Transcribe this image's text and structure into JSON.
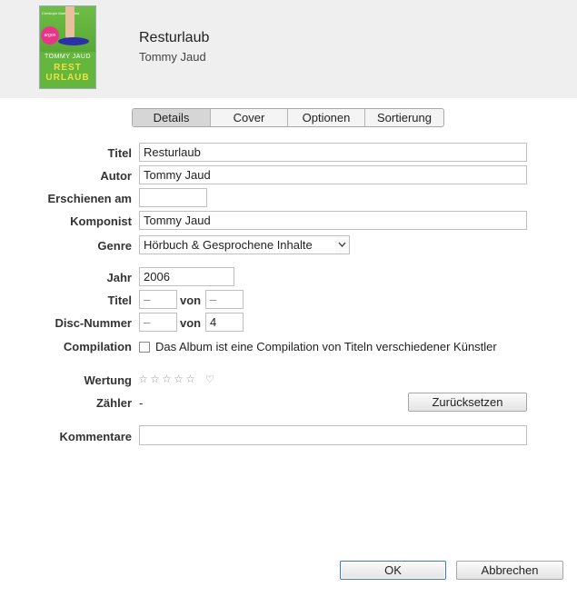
{
  "header": {
    "title": "Resturlaub",
    "artist": "Tommy Jaud",
    "cover": {
      "publisher_line": "Christoph Maria Herbst",
      "label": "argon",
      "author": "TOMMY JAUD",
      "title_line1": "REST",
      "title_line2": "URLAUB"
    }
  },
  "tabs": [
    {
      "label": "Details",
      "active": true
    },
    {
      "label": "Cover",
      "active": false
    },
    {
      "label": "Optionen",
      "active": false
    },
    {
      "label": "Sortierung",
      "active": false
    }
  ],
  "fields": {
    "titel": {
      "label": "Titel",
      "value": "Resturlaub"
    },
    "autor": {
      "label": "Autor",
      "value": "Tommy Jaud"
    },
    "erschienen": {
      "label": "Erschienen am",
      "value": ""
    },
    "komponist": {
      "label": "Komponist",
      "value": "Tommy Jaud"
    },
    "genre": {
      "label": "Genre",
      "value": "Hörbuch & Gesprochene Inhalte"
    },
    "jahr": {
      "label": "Jahr",
      "value": "2006"
    },
    "track": {
      "label": "Titel",
      "value": "–",
      "of_label": "von",
      "of_value": "–"
    },
    "disc": {
      "label": "Disc-Nummer",
      "value": "–",
      "of_label": "von",
      "of_value": "4"
    },
    "compilation": {
      "label": "Compilation",
      "checkbox_text": "Das Album ist eine Compilation von Titeln verschiedener Künstler",
      "checked": false
    },
    "wertung": {
      "label": "Wertung",
      "stars": 0,
      "star_char": "☆",
      "heart_char": "♡"
    },
    "zaehler": {
      "label": "Zähler",
      "value": "-",
      "reset_label": "Zurücksetzen"
    },
    "kommentare": {
      "label": "Kommentare",
      "value": ""
    }
  },
  "buttons": {
    "ok": "OK",
    "cancel": "Abbrechen"
  }
}
